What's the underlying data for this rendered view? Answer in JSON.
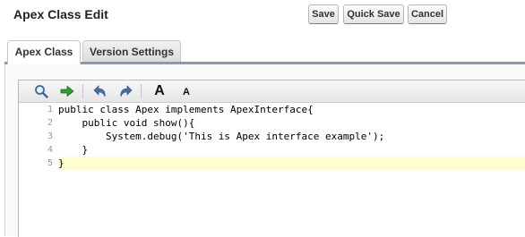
{
  "header": {
    "title": "Apex Class Edit",
    "buttons": {
      "save": "Save",
      "quick_save": "Quick Save",
      "cancel": "Cancel"
    }
  },
  "tabs": [
    {
      "label": "Apex Class",
      "active": true
    },
    {
      "label": "Version Settings",
      "active": false
    }
  ],
  "toolbar": {
    "icons": [
      "search-icon",
      "go-arrow-icon",
      "undo-icon",
      "redo-icon",
      "font-larger-icon",
      "font-smaller-icon"
    ],
    "font_larger_label": "A",
    "font_smaller_label": "A"
  },
  "editor": {
    "line_numbers": [
      "1",
      "2",
      "3",
      "4",
      "5"
    ],
    "lines": [
      "public class Apex implements ApexInterface{",
      "    public void show(){",
      "        System.debug('This is Apex interface example');",
      "    }",
      "}"
    ],
    "active_line": 5,
    "active_line_color": "#ffffcc"
  },
  "colors": {
    "tab_bar": "#8a9aab",
    "undo_redo": "#4a6ea9",
    "go_arrow": "#2e9e2e"
  }
}
